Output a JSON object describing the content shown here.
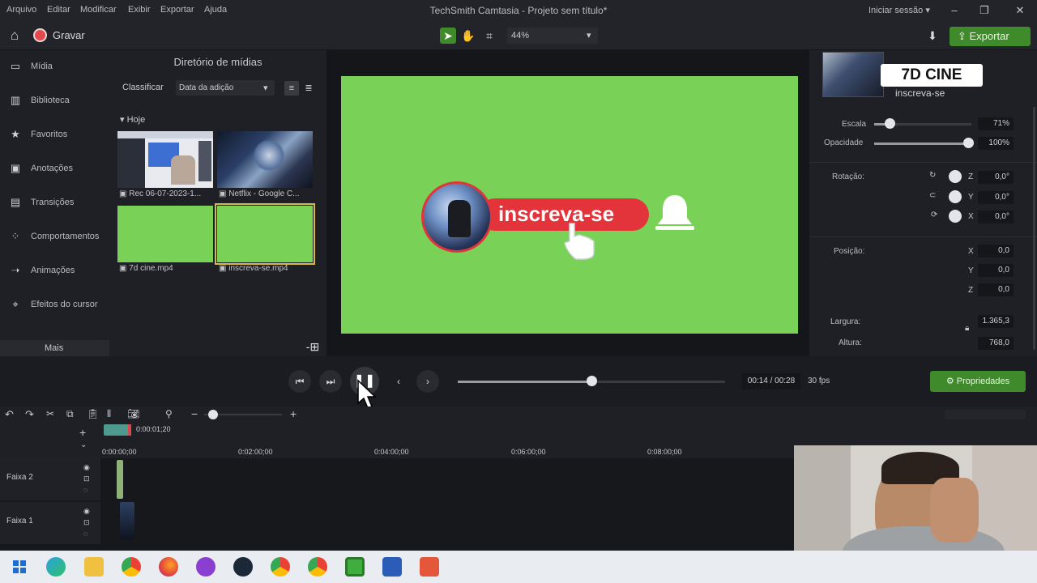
{
  "menubar": {
    "items": [
      "Arquivo",
      "Editar",
      "Modificar",
      "Exibir",
      "Exportar",
      "Ajuda"
    ],
    "title": "TechSmith Camtasia - Projeto sem título*",
    "signin": "Iniciar sessão"
  },
  "toolbar": {
    "record_label": "Gravar",
    "zoom": "44%",
    "export_label": "Exportar"
  },
  "sidebar": {
    "items": [
      {
        "label": "Mídia",
        "icon": "media-icon"
      },
      {
        "label": "Biblioteca",
        "icon": "library-icon"
      },
      {
        "label": "Favoritos",
        "icon": "star-icon"
      },
      {
        "label": "Anotações",
        "icon": "annotation-icon"
      },
      {
        "label": "Transições",
        "icon": "transition-icon"
      },
      {
        "label": "Comportamentos",
        "icon": "behavior-icon"
      },
      {
        "label": "Animações",
        "icon": "animation-icon"
      },
      {
        "label": "Efeitos do cursor",
        "icon": "cursor-icon"
      }
    ],
    "more_label": "Mais"
  },
  "media_bin": {
    "title": "Diretório de mídias",
    "sort_label": "Classificar",
    "sort_value": "Data da adição",
    "group": "Hoje",
    "items": [
      {
        "caption": "Rec 06-07-2023-1..."
      },
      {
        "caption": "Netflix - Google C..."
      },
      {
        "caption": "7d cine.mp4"
      },
      {
        "caption": "inscreva-se.mp4"
      }
    ]
  },
  "canvas": {
    "subscribe_text": "inscreva-se",
    "colors": {
      "green": "#79d257",
      "red": "#e2343a"
    }
  },
  "properties": {
    "preview_logo": "7D CINE",
    "clip_name": "inscreva-se",
    "scale_label": "Escala",
    "scale_value": "71%",
    "scale_fraction": 0.71,
    "opacity_label": "Opacidade",
    "opacity_value": "100%",
    "opacity_fraction": 1.0,
    "rotation_label": "Rotação:",
    "rotation": [
      {
        "axis": "Z",
        "value": "0,0°"
      },
      {
        "axis": "Y",
        "value": "0,0°"
      },
      {
        "axis": "X",
        "value": "0,0°"
      }
    ],
    "position_label": "Posição:",
    "position": [
      {
        "axis": "X",
        "value": "0,0"
      },
      {
        "axis": "Y",
        "value": "0,0"
      },
      {
        "axis": "Z",
        "value": "0,0"
      }
    ],
    "width_label": "Largura:",
    "width_value": "1.365,3",
    "height_label": "Altura:",
    "height_value": "768,0"
  },
  "playback": {
    "time": "00:14 / 00:28",
    "fps": "30 fps",
    "progress": 0.5,
    "properties_label": "Propriedades"
  },
  "timeline": {
    "playhead_time": "0:00:01;20",
    "ticks": [
      "0:00:00;00",
      "0:02:00;00",
      "0:04:00;00",
      "0:06:00;00",
      "0:08:00;00"
    ],
    "tracks": [
      "Faixa 2",
      "Faixa 1"
    ]
  },
  "taskbar": {
    "apps": [
      "windows-start-icon",
      "edge-icon",
      "file-explorer-icon",
      "chrome-icon",
      "firefox-icon",
      "app-icon",
      "steam-icon",
      "chrome-profile-icon",
      "chrome-profile-2-icon",
      "camtasia-icon",
      "word-icon",
      "camtasia-recorder-icon"
    ]
  }
}
